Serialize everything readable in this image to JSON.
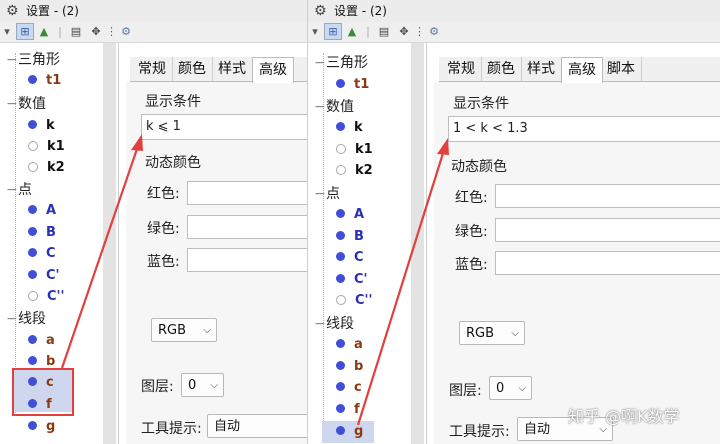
{
  "left_window": {
    "title": "设置 - (2)",
    "categories": [
      "三角形",
      "数值",
      "点",
      "线段"
    ],
    "triangle_items": [
      "t1"
    ],
    "number_items": [
      {
        "label": "k",
        "visible": true
      },
      {
        "label": "k1",
        "visible": false
      },
      {
        "label": "k2",
        "visible": false
      }
    ],
    "point_items": [
      {
        "label": "A",
        "visible": true
      },
      {
        "label": "B",
        "visible": true
      },
      {
        "label": "C",
        "visible": true
      },
      {
        "label": "C'",
        "visible": true
      },
      {
        "label": "C''",
        "visible": false
      }
    ],
    "segment_items": [
      {
        "label": "a",
        "visible": true
      },
      {
        "label": "b",
        "visible": true
      },
      {
        "label": "c",
        "visible": true,
        "selected": true
      },
      {
        "label": "f",
        "visible": true,
        "selected": true
      },
      {
        "label": "g",
        "visible": true
      }
    ],
    "tabs": [
      "常规",
      "颜色",
      "样式",
      "高级"
    ],
    "active_tab": "高级",
    "condition_title": "显示条件",
    "condition_value": "k ⩽ 1",
    "dynamic_color_title": "动态颜色",
    "red_label": "红色:",
    "green_label": "绿色:",
    "blue_label": "蓝色:",
    "color_mode": "RGB",
    "layer_label": "图层:",
    "layer_value": "0",
    "tooltip_label": "工具提示:",
    "tooltip_value": "自动"
  },
  "right_window": {
    "title": "设置 - (2)",
    "categories": [
      "三角形",
      "数值",
      "点",
      "线段"
    ],
    "triangle_items": [
      "t1"
    ],
    "number_items": [
      {
        "label": "k",
        "visible": true
      },
      {
        "label": "k1",
        "visible": false
      },
      {
        "label": "k2",
        "visible": false
      }
    ],
    "point_items": [
      {
        "label": "A",
        "visible": true
      },
      {
        "label": "B",
        "visible": true
      },
      {
        "label": "C",
        "visible": true
      },
      {
        "label": "C'",
        "visible": true
      },
      {
        "label": "C''",
        "visible": false
      }
    ],
    "segment_items": [
      {
        "label": "a",
        "visible": true
      },
      {
        "label": "b",
        "visible": true
      },
      {
        "label": "c",
        "visible": true
      },
      {
        "label": "f",
        "visible": true
      },
      {
        "label": "g",
        "visible": true,
        "selected": true
      }
    ],
    "tabs": [
      "常规",
      "颜色",
      "样式",
      "高级",
      "脚本"
    ],
    "active_tab": "高级",
    "condition_title": "显示条件",
    "condition_value": "1 < k < 1.3",
    "dynamic_color_title": "动态颜色",
    "red_label": "红色:",
    "green_label": "绿色:",
    "blue_label": "蓝色:",
    "color_mode": "RGB",
    "layer_label": "图层:",
    "layer_value": "0",
    "tooltip_label": "工具提示:",
    "tooltip_value": "自动"
  },
  "watermark": "知乎 @啊K数学",
  "colors": {
    "point_dot": "#3f4fd6",
    "number_text": "#111111",
    "point_text": "#2b2fb4",
    "object_text": "#8a3a12",
    "segment_text": "#8a3a12",
    "annotation_red": "#e2403e"
  }
}
